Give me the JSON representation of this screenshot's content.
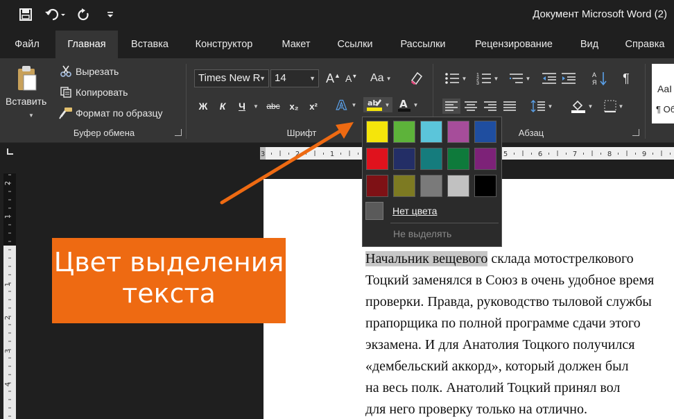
{
  "window": {
    "title": "Документ Microsoft Word (2)"
  },
  "tabs": [
    "Файл",
    "Главная",
    "Вставка",
    "Конструктор",
    "Макет",
    "Ссылки",
    "Рассылки",
    "Рецензирование",
    "Вид",
    "Справка"
  ],
  "active_tab": "Главная",
  "clipboard": {
    "paste_label": "Вставить",
    "cut_label": "Вырезать",
    "copy_label": "Копировать",
    "format_painter_label": "Формат по образцу",
    "group_label": "Буфер обмена"
  },
  "font": {
    "name": "Times New R",
    "size": "14",
    "case_label": "Aa",
    "bold": "Ж",
    "italic": "К",
    "underline": "Ч",
    "strike": "abc",
    "subscript": "x₂",
    "superscript": "x²",
    "group_label": "Шрифт"
  },
  "paragraph": {
    "group_label": "Абзац"
  },
  "styles": {
    "preview_top": "AaI",
    "preview_bottom": "¶ Об"
  },
  "highlight_palette": {
    "colors": [
      "#f5e50b",
      "#5db33a",
      "#5bc5da",
      "#a64d9a",
      "#1f4ea0",
      "#e0121d",
      "#232e66",
      "#157c7d",
      "#0e7a3b",
      "#7d2278",
      "#7e1115",
      "#7d7a22",
      "#7a7a7a",
      "#c1c1c1",
      "#000000"
    ],
    "no_color_label": "Нет цвета",
    "stop_label": "Не выделять"
  },
  "callout": {
    "line1": "Цвет выделения",
    "line2": "текста"
  },
  "ruler": {
    "numbers": [
      "3",
      "2",
      "1",
      "1",
      "2",
      "3",
      "4",
      "5",
      "6",
      "7",
      "8",
      "9",
      "10"
    ]
  },
  "document": {
    "lines": [
      "склада мотострелкового",
      "Тоцкий заменялся в Союз в очень удобное время",
      "проверки. Правда, руководство тыловой службы",
      "прапорщика по полной программе сдачи этого",
      "экзамена. И для Анатолия Тоцкого получился",
      "«дембельский аккорд», который должен был",
      "на весь полк. Анатолий Тоцкий принял вол",
      "для него проверку только на отлично."
    ],
    "highlighted": "Начальник вещевого"
  }
}
